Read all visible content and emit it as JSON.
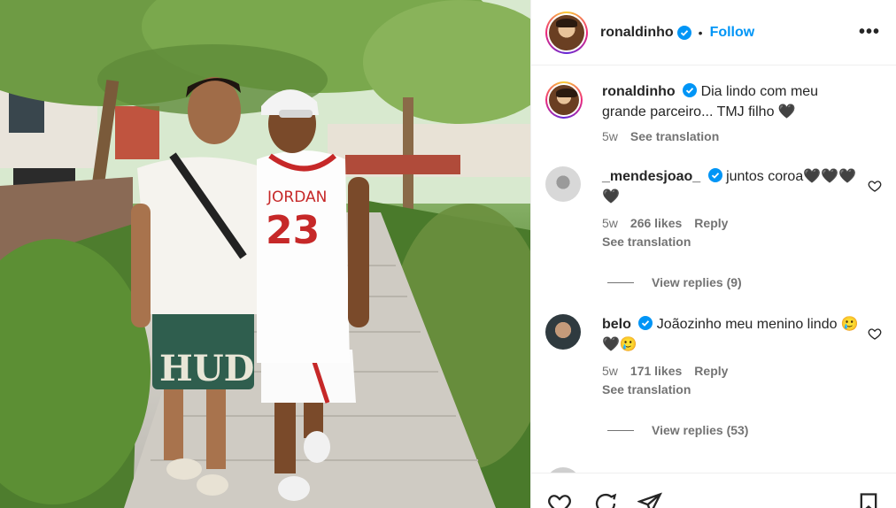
{
  "post": {
    "username": "ronaldinho",
    "follow_label": "Follow",
    "dot": "•",
    "more_label": "•••"
  },
  "caption": {
    "username": "ronaldinho",
    "text": "Dia lindo com meu grande parceiro... TMJ filho 🖤",
    "time": "5w",
    "see_translation": "See translation"
  },
  "comments": [
    {
      "username": "_mendesjoao_",
      "text": "juntos coroa🖤🖤🖤🖤",
      "time": "5w",
      "likes": "266 likes",
      "reply": "Reply",
      "see_translation": "See translation",
      "view_replies": "View replies (9)"
    },
    {
      "username": "belo",
      "text": "Joãozinho meu menino lindo 🥲🖤🥲",
      "time": "5w",
      "likes": "171 likes",
      "reply": "Reply",
      "see_translation": "See translation",
      "view_replies": "View replies (53)"
    }
  ],
  "colors": {
    "accent": "#0095f6",
    "text": "#262626",
    "muted": "#737373"
  },
  "photo": {
    "jersey_text": "JORDAN",
    "jersey_number": "23",
    "shorts_text": "HUD"
  }
}
